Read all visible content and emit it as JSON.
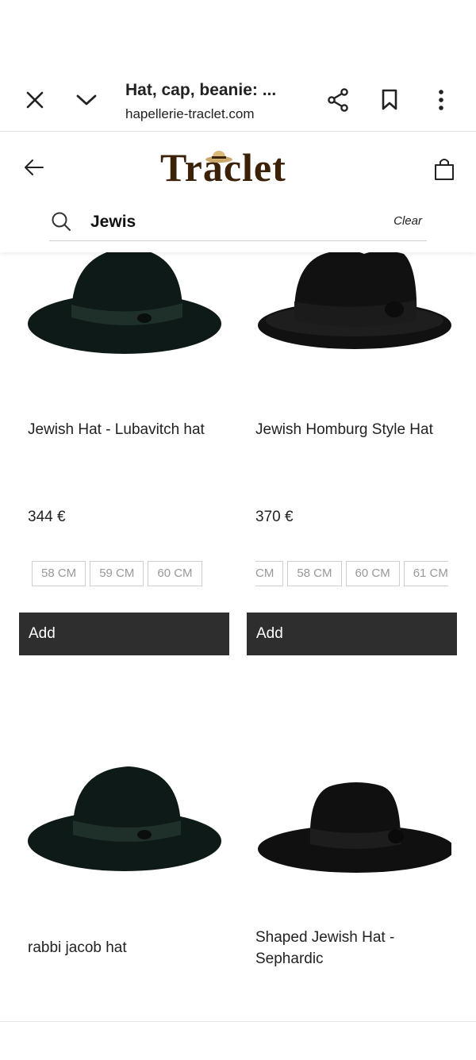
{
  "browser": {
    "title": "Hat, cap, beanie: ...",
    "url": "hapellerie-traclet.com"
  },
  "site": {
    "logo_text": "Traclet",
    "search_value": "Jewis",
    "clear_label": "Clear"
  },
  "products": [
    {
      "name": "Jewish Hat - Lubavitch hat",
      "price": "344 €",
      "sizes": [
        "58 CM",
        "59 CM",
        "60 CM"
      ],
      "add_label": "Add",
      "hat_color": "#0e1a17",
      "band_color": "#1f302b"
    },
    {
      "name": "Jewish Homburg Style Hat",
      "price": "370 €",
      "sizes": [
        "CM",
        "58 CM",
        "60 CM",
        "61 CM"
      ],
      "add_label": "Add",
      "hat_color": "#111111",
      "band_color": "#1b1b1b"
    },
    {
      "name": "rabbi jacob hat",
      "hat_color": "#0e1a17",
      "band_color": "#1f302b"
    },
    {
      "name": "Shaped Jewish Hat - Sephardic",
      "hat_color": "#101010",
      "band_color": "#1d1d1d"
    }
  ]
}
